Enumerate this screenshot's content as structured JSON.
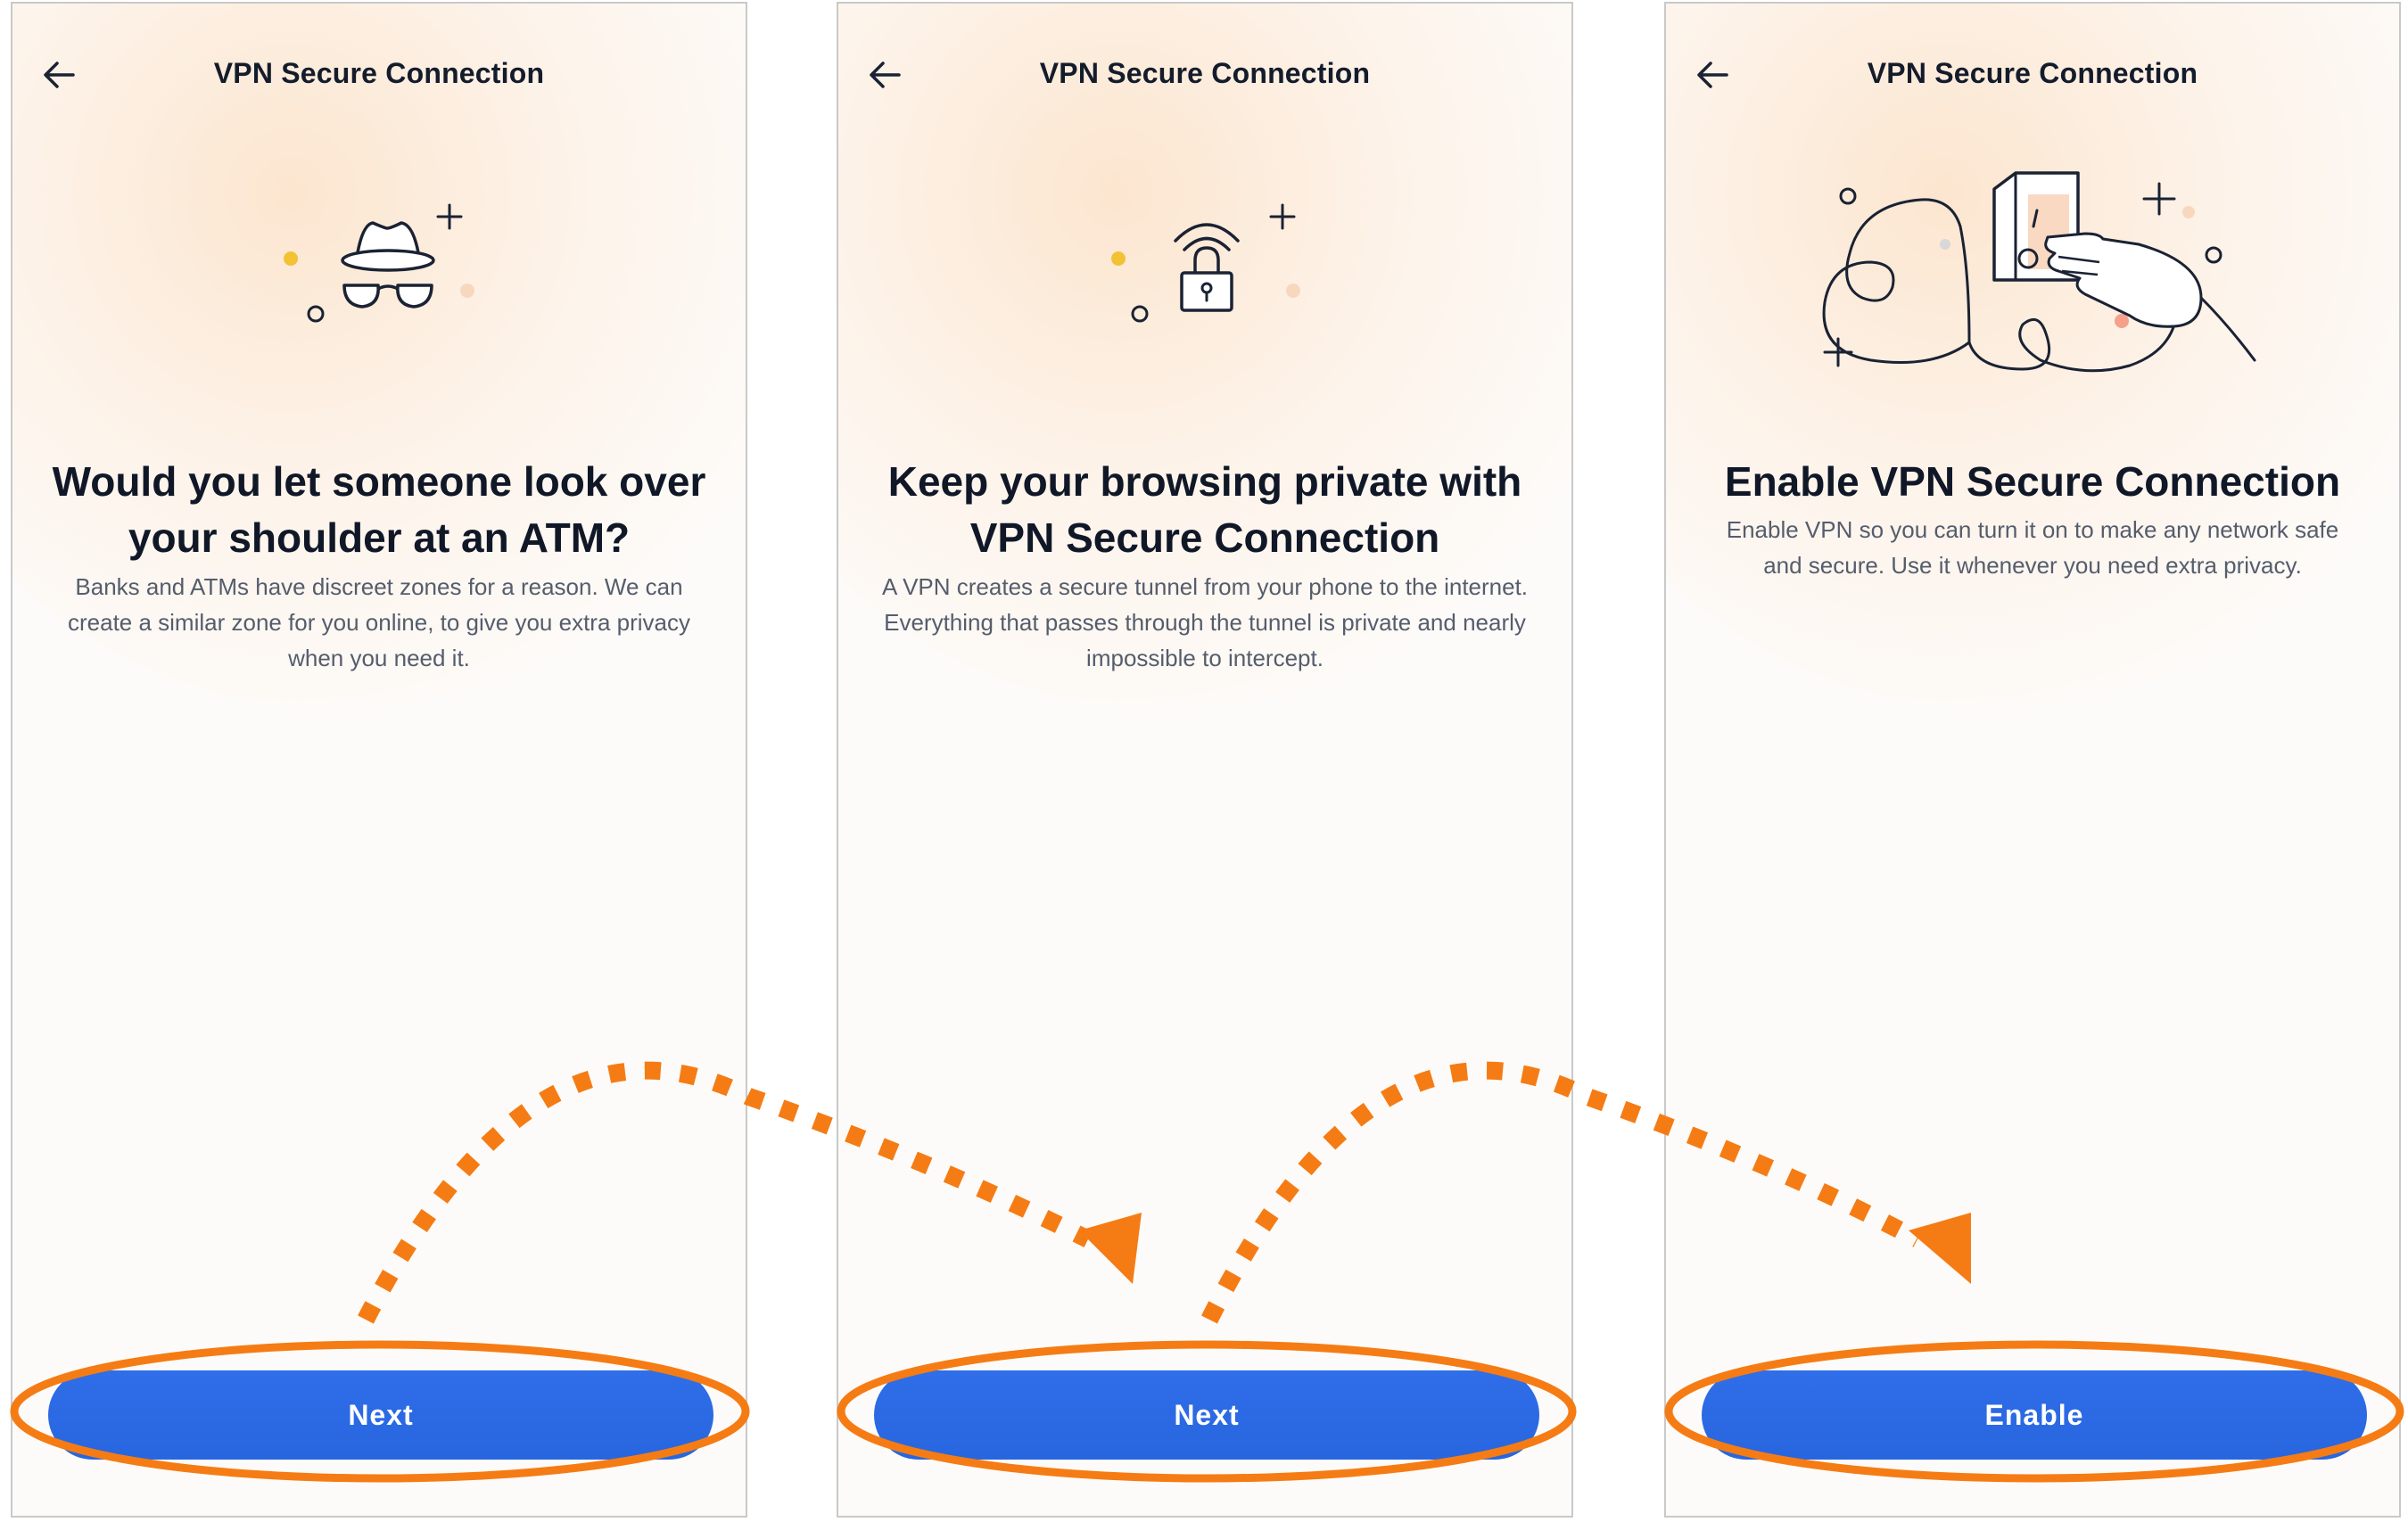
{
  "screens": [
    {
      "title": "VPN Secure Connection",
      "heading_line1": "Would you let someone look over",
      "heading_line2": "your shoulder at an ATM?",
      "body_line1": "Banks and ATMs have discreet zones for a reason. We can",
      "body_line2": "create a similar zone for you online, to give you extra privacy",
      "body_line3": "when you need it.",
      "button_label": "Next",
      "illustration": "incognito-icon"
    },
    {
      "title": "VPN Secure Connection",
      "heading_line1": "Keep your browsing private with",
      "heading_line2": "VPN Secure Connection",
      "body_line1": "A VPN creates a secure tunnel from your phone to the internet.",
      "body_line2": "Everything that passes through the tunnel is private and nearly",
      "body_line3": "impossible to intercept.",
      "button_label": "Next",
      "illustration": "wifi-lock-icon"
    },
    {
      "title": "VPN Secure Connection",
      "heading_line1": "Enable VPN Secure Connection",
      "heading_line2": "",
      "body_line1": "Enable VPN so you can turn it on to make any network safe",
      "body_line2": "and secure. Use it whenever you need extra privacy.",
      "body_line3": "",
      "button_label": "Enable",
      "illustration": "hand-switch-icon"
    }
  ],
  "colors": {
    "button_blue": "#2b6be4",
    "annotation_orange": "#f57c14",
    "title_text": "#141c2c",
    "body_text": "#555d6c"
  }
}
